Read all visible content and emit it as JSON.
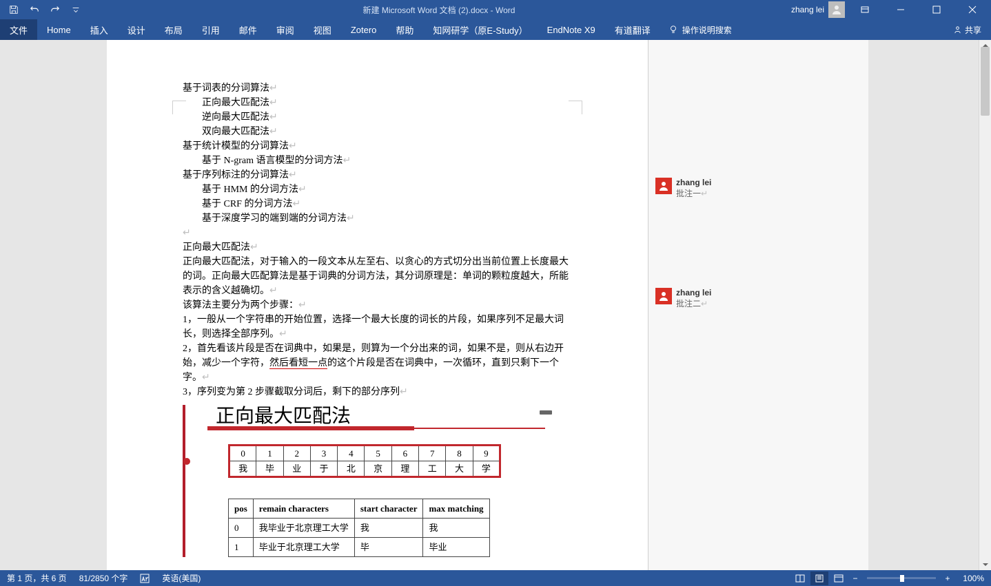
{
  "title": "新建 Microsoft Word 文档 (2).docx  -  Word",
  "user": "zhang lei",
  "tabs": {
    "file": "文件",
    "items": [
      "Home",
      "插入",
      "设计",
      "布局",
      "引用",
      "邮件",
      "审阅",
      "视图",
      "Zotero",
      "帮助",
      "知网研学（原E-Study）",
      "EndNote X9",
      "有道翻译"
    ],
    "tell_me": "操作说明搜索",
    "share": "共享"
  },
  "doc": {
    "l1": "基于词表的分词算法",
    "l2": "正向最大匹配法",
    "l3": "逆向最大匹配法",
    "l4": "双向最大匹配法",
    "l5": "基于统计模型的分词算法",
    "l6": "基于 N-gram 语言模型的分词方法",
    "l7": "基于序列标注的分词算法",
    "l8": "基于 HMM 的分词方法",
    "l9": "基于 CRF 的分词方法",
    "l10": "基于深度学习的端到端的分词方法",
    "h1": "正向最大匹配法",
    "p1": "正向最大匹配法，对于输入的一段文本从左至右、以贪心的方式切分出当前位置上长度最大的词。正向最大匹配算法是基于词典的分词方法，其分词原理是：单词的颗粒度越大，所能表示的含义越确切。",
    "p2": "该算法主要分为两个步骤：",
    "p3": "1，一般从一个字符串的开始位置，选择一个最大长度的词长的片段，如果序列不足最大词长，则选择全部序列。",
    "p4a": "2，首先看该片段是否在词典中，如果是，则算为一个分出来的词，如果不是，则从右边开始，减少一个字符，",
    "p4b": "然后看短一点",
    "p4c": "的这个片段是否在词典中，一次循环，直到只剩下一个字。",
    "p5": "3，序列变为第 2 步骤截取分词后，剩下的部分序列"
  },
  "fig": {
    "title": "正向最大匹配法",
    "nums": [
      "0",
      "1",
      "2",
      "3",
      "4",
      "5",
      "6",
      "7",
      "8",
      "9"
    ],
    "chars": [
      "我",
      "毕",
      "业",
      "于",
      "北",
      "京",
      "理",
      "工",
      "大",
      "学"
    ]
  },
  "tbl": {
    "headers": [
      "pos",
      "remain characters",
      "start character",
      "max matching"
    ],
    "rows": [
      [
        "0",
        "我毕业于北京理工大学",
        "我",
        "我"
      ],
      [
        "1",
        "毕业于北京理工大学",
        "毕",
        "毕业"
      ]
    ]
  },
  "comments": [
    {
      "author": "zhang lei",
      "text": "批注一"
    },
    {
      "author": "zhang lei",
      "text": "批注二"
    }
  ],
  "status": {
    "page": "第 1 页，共 6 页",
    "words": "81/2850 个字",
    "lang": "英语(美国)",
    "zoom": "100%"
  }
}
